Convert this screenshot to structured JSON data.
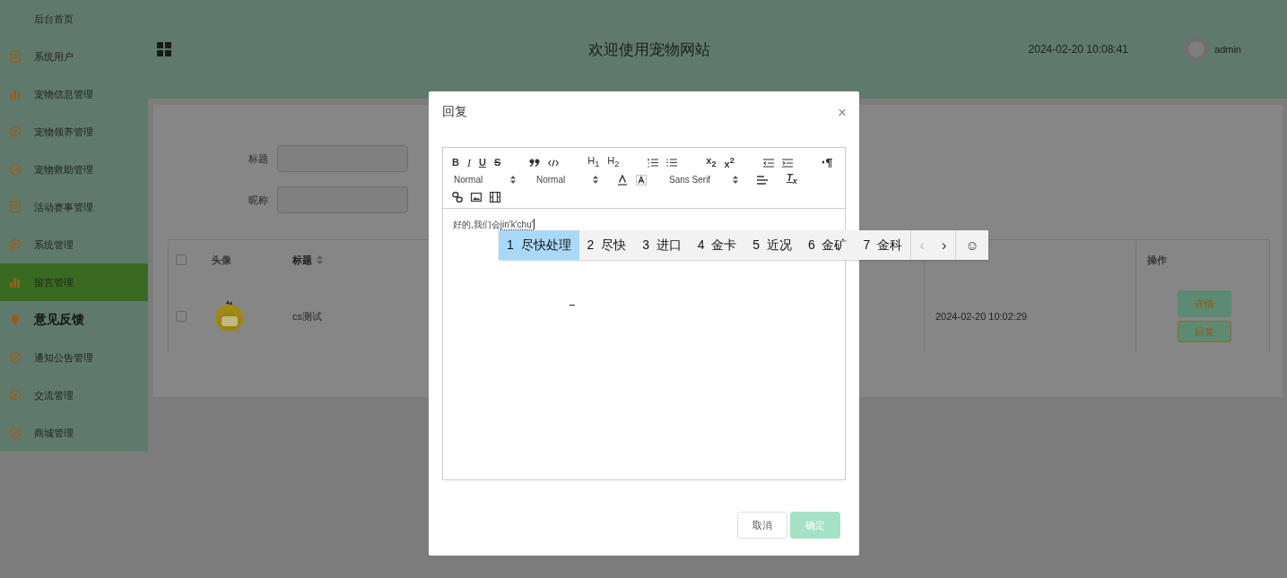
{
  "sidebar": {
    "items": [
      {
        "label": "后台首页",
        "selected": false,
        "hovered": false
      },
      {
        "label": "系统用户",
        "selected": false,
        "hovered": false
      },
      {
        "label": "宠物信息管理",
        "selected": false,
        "hovered": false
      },
      {
        "label": "宠物领养管理",
        "selected": false,
        "hovered": false
      },
      {
        "label": "宠物救助管理",
        "selected": false,
        "hovered": false
      },
      {
        "label": "活动赛事管理",
        "selected": false,
        "hovered": false
      },
      {
        "label": "系统管理",
        "selected": false,
        "hovered": false
      },
      {
        "label": "留言管理",
        "selected": true,
        "hovered": false
      },
      {
        "label": "意见反馈",
        "selected": false,
        "hovered": true
      },
      {
        "label": "通知公告管理",
        "selected": false,
        "hovered": false
      },
      {
        "label": "交流管理",
        "selected": false,
        "hovered": false
      },
      {
        "label": "商城管理",
        "selected": false,
        "hovered": false
      }
    ]
  },
  "header": {
    "title": "欢迎使用宠物网站",
    "time": "2024-02-20 10:08:41",
    "user": "admin"
  },
  "search": [
    {
      "label": "标题"
    },
    {
      "label": "昵称"
    }
  ],
  "table": {
    "all_checked": false,
    "columns": [
      {
        "label": "头像",
        "sortable": false
      },
      {
        "label": "标题",
        "sortable": true
      },
      {
        "label": "操作",
        "sortable": false
      }
    ],
    "rows": [
      {
        "checked": false,
        "title": "cs测试",
        "updated": "2024-02-20 10:02:29",
        "actions": [
          "详情",
          "回复"
        ]
      }
    ]
  },
  "dialog": {
    "title": "回复",
    "close": "×",
    "toolbar": {
      "glyphs": [
        "B",
        "I",
        "U",
        "S",
        "H$_{1}$",
        "H$_{2}$",
        "x$_{2}$",
        "x$^{2}$",
        "T$_{x}$"
      ],
      "selects": [
        "Normal",
        "Normal",
        "Sans Serif"
      ]
    },
    "content": {
      "text": "好的,我们会",
      "composition": "jin'k'chu'"
    },
    "buttons": [
      {
        "label": "取消",
        "primary": false
      },
      {
        "label": "确定",
        "primary": true
      }
    ]
  },
  "ime": {
    "candidates": [
      {
        "index": "1",
        "text": "尽快处理",
        "selected": true
      },
      {
        "index": "2",
        "text": "尽快",
        "selected": false
      },
      {
        "index": "3",
        "text": "进口",
        "selected": false
      },
      {
        "index": "4",
        "text": "金卡",
        "selected": false
      },
      {
        "index": "5",
        "text": "近况",
        "selected": false
      },
      {
        "index": "6",
        "text": "金矿",
        "selected": false
      },
      {
        "index": "7",
        "text": "金科",
        "selected": false
      }
    ],
    "prev": {
      "label": "‹",
      "disabled": true
    },
    "next": {
      "label": "›",
      "disabled": false
    },
    "emoji": "☺"
  }
}
